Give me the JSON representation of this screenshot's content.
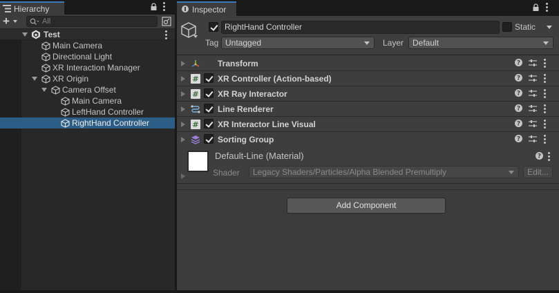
{
  "colors": {
    "accent": "#3a79bb",
    "selection": "#2c5d87",
    "panel": "#3c3c3c"
  },
  "hierarchy": {
    "tab_label": "Hierarchy",
    "tab_icon": "hierarchy-list-icon",
    "search_placeholder": "All",
    "scene": {
      "label": "Test",
      "icon": "unity-scene-icon"
    },
    "items": [
      {
        "label": "Main Camera",
        "icon": "gameobject-cube-icon"
      },
      {
        "label": "Directional Light",
        "icon": "gameobject-cube-icon"
      },
      {
        "label": "XR Interaction Manager",
        "icon": "gameobject-cube-icon"
      },
      {
        "label": "XR Origin",
        "icon": "gameobject-cube-icon"
      },
      {
        "label": "Camera Offset",
        "icon": "gameobject-cube-icon"
      },
      {
        "label": "Main Camera",
        "icon": "gameobject-cube-icon"
      },
      {
        "label": "LeftHand Controller",
        "icon": "gameobject-cube-icon"
      },
      {
        "label": "RightHand Controller",
        "icon": "gameobject-cube-icon",
        "selected": true
      }
    ]
  },
  "inspector": {
    "tab_label": "Inspector",
    "tab_icon": "info-icon",
    "gameobject": {
      "name": "RightHand Controller",
      "active": true,
      "static_label": "Static",
      "static": false,
      "tag_label": "Tag",
      "tag_value": "Untagged",
      "layer_label": "Layer",
      "layer_value": "Default"
    },
    "components": [
      {
        "name": "Transform",
        "icon": "transform-axes-icon",
        "has_checkbox": false,
        "enabled": true
      },
      {
        "name": "XR Controller (Action-based)",
        "icon": "script-hash-icon",
        "has_checkbox": true,
        "enabled": true
      },
      {
        "name": "XR Ray Interactor",
        "icon": "script-hash-icon",
        "has_checkbox": true,
        "enabled": true
      },
      {
        "name": "Line Renderer",
        "icon": "line-renderer-icon",
        "has_checkbox": true,
        "enabled": true
      },
      {
        "name": "XR Interactor Line Visual",
        "icon": "script-hash-icon",
        "has_checkbox": true,
        "enabled": true
      },
      {
        "name": "Sorting Group",
        "icon": "sorting-group-layers-icon",
        "has_checkbox": true,
        "enabled": true
      }
    ],
    "material": {
      "name": "Default-Line (Material)",
      "shader_label": "Shader",
      "shader_value": "Legacy Shaders/Particles/Alpha Blended Premultiply",
      "edit_label": "Edit..."
    },
    "add_component_label": "Add Component"
  }
}
